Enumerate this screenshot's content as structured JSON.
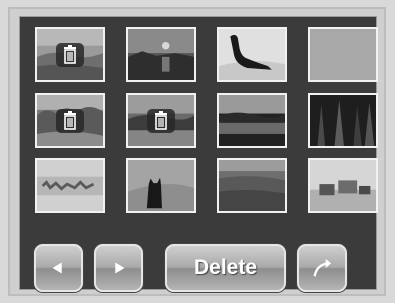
{
  "thumbnails": [
    {
      "scene": "field-landscape",
      "marked_for_delete": true
    },
    {
      "scene": "sunset-lake",
      "marked_for_delete": false
    },
    {
      "scene": "dog-on-sand",
      "marked_for_delete": false
    },
    {
      "scene": "blank-grey",
      "marked_for_delete": false
    },
    {
      "scene": "trees-landscape",
      "marked_for_delete": true
    },
    {
      "scene": "lake-dusk",
      "marked_for_delete": true
    },
    {
      "scene": "dark-lake",
      "marked_for_delete": false
    },
    {
      "scene": "forest",
      "marked_for_delete": false
    },
    {
      "scene": "snowy-shore",
      "marked_for_delete": false
    },
    {
      "scene": "cat-silhouette",
      "marked_for_delete": false
    },
    {
      "scene": "grass-field",
      "marked_for_delete": false
    },
    {
      "scene": "seaside-buildings",
      "marked_for_delete": false
    }
  ],
  "buttons": {
    "prev_icon": "left-triangle-icon",
    "next_icon": "right-triangle-icon",
    "delete_label": "Delete",
    "share_icon": "curved-arrow-icon"
  },
  "colors": {
    "screen_bg": "#3b3b3b",
    "button_text": "#ffffff",
    "thumb_border": "#f1f1f1"
  }
}
